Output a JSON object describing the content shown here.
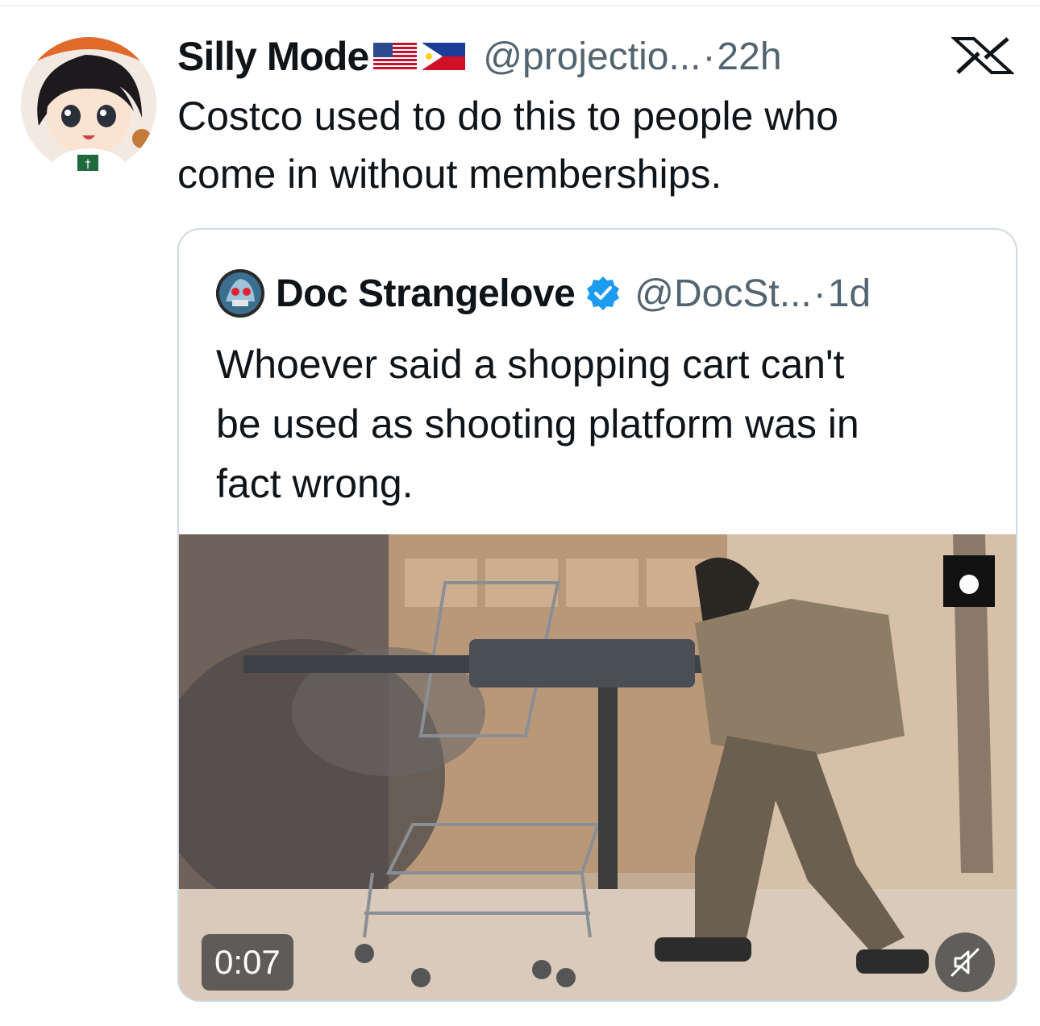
{
  "tweet": {
    "display_name": "Silly Mode",
    "handle": "@projectio...",
    "separator": "·",
    "time": "22h",
    "text": "Costco used to do this to people who\ncome in without memberships.",
    "flags": [
      "us-flag-icon",
      "philippines-flag-icon"
    ]
  },
  "quoted_tweet": {
    "display_name": "Doc Strangelove",
    "handle": "@DocSt...",
    "separator": "·",
    "time": "1d",
    "verified": true,
    "text": "Whoever said a shopping cart can't\nbe used as shooting platform was in\nfact wrong.",
    "video": {
      "duration": "0:07",
      "muted": true
    }
  },
  "colors": {
    "text_primary": "#0f1419",
    "text_secondary": "#536471",
    "verified_blue": "#1d9bf0",
    "card_border": "#cfd9de"
  },
  "icons": {
    "close": "x-logo-icon",
    "verified": "verified-badge-icon",
    "mute": "muted-speaker-icon"
  }
}
